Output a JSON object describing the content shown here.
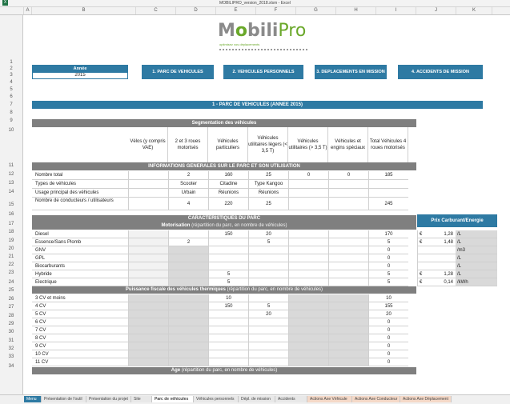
{
  "window": {
    "title": "MOBILIPRO_version_2018.xlsm - Excel"
  },
  "columns": [
    "A",
    "B",
    "C",
    "D",
    "E",
    "F",
    "G",
    "H",
    "I",
    "J",
    "K"
  ],
  "rows": [
    "1",
    "2",
    "3",
    "4",
    "5",
    "6",
    "7",
    "8",
    "9",
    "10",
    "11",
    "12",
    "13",
    "14",
    "15",
    "16",
    "17",
    "18",
    "19",
    "20",
    "21",
    "22",
    "23",
    "24",
    "25",
    "26",
    "27",
    "28",
    "29",
    "30",
    "31",
    "32",
    "33",
    "34"
  ],
  "logo": {
    "m": "M",
    "o": "o",
    "bili": "bili",
    "pro": "Pro",
    "tagline": "optimisez vos déplacements"
  },
  "year": {
    "label": "Année",
    "value": "2015"
  },
  "nav": [
    "1. PARC DE VEHICULES",
    "2. VEHICULES PERSONNELS",
    "3. DEPLACEMENTS EN MISSION",
    "4. ACCIDENTS DE MISSION"
  ],
  "section_title": "1 - PARC DE VEHICULES (ANNEE 2015)",
  "segmentation_title": "Segmentation des véhicules",
  "col_headers": [
    "Vélos (y compris VAE)",
    "2 et 3 roues motorisés",
    "Véhicules particuliers",
    "Véhicules utilitaires légers (< 3,5 T)",
    "Véhicules utilitaires (> 3,5 T)",
    "Véhicules et engins spéciaux",
    "Total Véhicules 4 roues motorisés"
  ],
  "info_title": "INFORMATIONS GENERALES SUR LE PARC ET SON UTILISATION",
  "info_rows": [
    {
      "label": "Nombre total",
      "vals": [
        "",
        "2",
        "160",
        "25",
        "0",
        "0",
        "185"
      ]
    },
    {
      "label": "Types de véhicules",
      "vals": [
        "",
        "Scooter",
        "Citadine",
        "Type Kangoo",
        "",
        "",
        ""
      ]
    },
    {
      "label": "Usage principal des véhicules",
      "vals": [
        "",
        "Urbain",
        "Réunions",
        "Réunions",
        "",
        "",
        ""
      ]
    },
    {
      "label": "Nombre de conducteurs / utilisateurs",
      "vals": [
        "",
        "4",
        "220",
        "25",
        "",
        "",
        "245"
      ]
    }
  ],
  "caract_title": "CARACTERISTIQUES DU PARC",
  "motor_title": "Motorisation",
  "motor_sub": "(répartition du parc, en nombre de véhicules)",
  "motor_rows": [
    {
      "label": "Diesel",
      "vals": [
        "",
        "",
        "150",
        "20",
        "",
        "",
        "170"
      ]
    },
    {
      "label": "Essence/Sans Plomb",
      "vals": [
        "",
        "2",
        "",
        "5",
        "",
        "",
        "5"
      ]
    },
    {
      "label": "GNV",
      "vals": [
        "",
        "",
        "",
        "",
        "",
        "",
        "0"
      ]
    },
    {
      "label": "GPL",
      "vals": [
        "",
        "",
        "",
        "",
        "",
        "",
        "0"
      ]
    },
    {
      "label": "Biocarburants",
      "vals": [
        "",
        "",
        "",
        "",
        "",
        "",
        "0"
      ]
    },
    {
      "label": "Hybride",
      "vals": [
        "",
        "",
        "5",
        "",
        "",
        "",
        "5"
      ]
    },
    {
      "label": "Electrique",
      "vals": [
        "",
        "",
        "5",
        "",
        "",
        "",
        "5"
      ]
    }
  ],
  "fuel": {
    "title": "Prix Carburant/Energie",
    "rows": [
      {
        "cur": "€",
        "price": "1,28",
        "unit": "/L"
      },
      {
        "cur": "€",
        "price": "1,48",
        "unit": "/L"
      },
      {
        "cur": "",
        "price": "",
        "unit": "/m3"
      },
      {
        "cur": "",
        "price": "",
        "unit": "/L"
      },
      {
        "cur": "",
        "price": "",
        "unit": "/L"
      },
      {
        "cur": "€",
        "price": "1,28",
        "unit": "/L"
      },
      {
        "cur": "€",
        "price": "0,14",
        "unit": "/kWh"
      }
    ]
  },
  "puissance_title": "Puissance fiscale des véhicules thermiques",
  "puissance_sub": "(répartition du parc, en nombre de véhicules)",
  "puissance_rows": [
    {
      "label": "3 CV et moins",
      "vals": [
        "",
        "",
        "10",
        "",
        "",
        "",
        "10"
      ]
    },
    {
      "label": "4 CV",
      "vals": [
        "",
        "",
        "150",
        "5",
        "",
        "",
        "155"
      ]
    },
    {
      "label": "5 CV",
      "vals": [
        "",
        "",
        "",
        "20",
        "",
        "",
        "20"
      ]
    },
    {
      "label": "6 CV",
      "vals": [
        "",
        "",
        "",
        "",
        "",
        "",
        "0"
      ]
    },
    {
      "label": "7 CV",
      "vals": [
        "",
        "",
        "",
        "",
        "",
        "",
        "0"
      ]
    },
    {
      "label": "8 CV",
      "vals": [
        "",
        "",
        "",
        "",
        "",
        "",
        "0"
      ]
    },
    {
      "label": "9 CV",
      "vals": [
        "",
        "",
        "",
        "",
        "",
        "",
        "0"
      ]
    },
    {
      "label": "10 CV",
      "vals": [
        "",
        "",
        "",
        "",
        "",
        "",
        "0"
      ]
    },
    {
      "label": "11 CV",
      "vals": [
        "",
        "",
        "",
        "",
        "",
        "",
        "0"
      ]
    }
  ],
  "age_title": "Age",
  "age_sub": "(répartition du parc, en nombre de véhicules)",
  "tabs": [
    "Menu",
    "Présentation de l'outil",
    "Présentation du projet",
    "Site",
    "Parc de véhicules",
    "Véhicules personnels",
    "Dépl. de mission",
    "Accidents",
    "Actions Axe Véhicule",
    "Actions Axe Conducteur",
    "Actions Axe Déplacement"
  ],
  "colors": {
    "teal": "#2e7aa3",
    "grey": "#7f7f7f",
    "green": "#6aa82a",
    "shade": "#d9d9d9"
  }
}
